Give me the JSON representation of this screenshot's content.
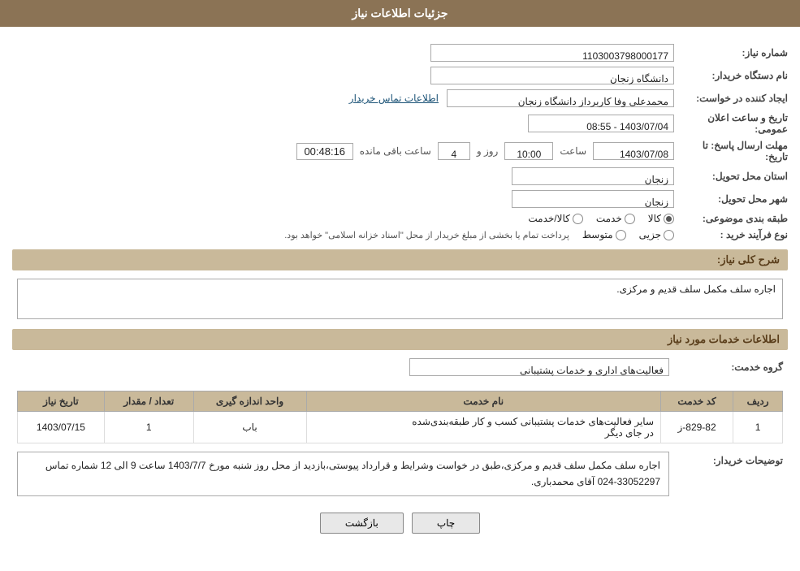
{
  "page": {
    "title": "جزئیات اطلاعات نیاز"
  },
  "header": {
    "title": "جزئیات اطلاعات نیاز"
  },
  "fields": {
    "need_number_label": "شماره نیاز:",
    "need_number_value": "1103003798000177",
    "buyer_org_label": "نام دستگاه خریدار:",
    "buyer_org_value": "دانشگاه زنجان",
    "creator_label": "ایجاد کننده در خواست:",
    "creator_value": "محمدعلی وفا کاربرداز دانشگاه زنجان",
    "contact_link": "اطلاعات تماس خریدار",
    "announce_datetime_label": "تاریخ و ساعت اعلان عمومی:",
    "announce_datetime_value": "1403/07/04 - 08:55",
    "response_deadline_label": "مهلت ارسال پاسخ: تا تاریخ:",
    "response_date": "1403/07/08",
    "response_time_label": "ساعت",
    "response_time": "10:00",
    "response_days_label": "روز و",
    "response_days": "4",
    "remaining_label": "ساعت باقی مانده",
    "remaining_time": "00:48:16",
    "province_label": "استان محل تحویل:",
    "province_value": "زنجان",
    "city_label": "شهر محل تحویل:",
    "city_value": "زنجان",
    "category_label": "طبقه بندی موضوعی:",
    "category_options": [
      "کالا",
      "خدمت",
      "کالا/خدمت"
    ],
    "category_selected": "کالا",
    "purchase_type_label": "نوع فرآیند خرید :",
    "purchase_type_options": [
      "جزیی",
      "متوسط"
    ],
    "purchase_type_note": "پرداخت تمام یا بخشی از مبلغ خریدار از محل \"اسناد خزانه اسلامی\" خواهد بود.",
    "description_label": "شرح کلی نیاز:",
    "description_value": "اجاره سلف مکمل سلف قدیم و مرکزی.",
    "services_section_label": "اطلاعات خدمات مورد نیاز",
    "service_group_label": "گروه خدمت:",
    "service_group_value": "فعالیت‌های اداری و خدمات پشتیبانی",
    "table": {
      "columns": [
        "ردیف",
        "کد خدمت",
        "نام خدمت",
        "واحد اندازه گیری",
        "تعداد / مقدار",
        "تاریخ نیاز"
      ],
      "rows": [
        {
          "row_num": "1",
          "service_code": "829-82-ز",
          "service_name": "سایر فعالیت‌های خدمات پشتیبانی کسب و کار طبقه‌بندی‌شده در جای دیگر",
          "unit": "باب",
          "quantity": "1",
          "date": "1403/07/15"
        }
      ]
    },
    "buyer_notes_label": "توضیحات خریدار:",
    "buyer_notes_value": "اجاره سلف مکمل سلف قدیم و مرکزی،طبق در خواست وشرایط و قرارداد پیوستی،بازدید از محل روز شنبه مورخ 1403/7/7 ساعت 9 الی 12 شماره تماس 33052297-024 آقای محمدباری.",
    "buttons": {
      "print": "چاپ",
      "back": "بازگشت"
    }
  }
}
